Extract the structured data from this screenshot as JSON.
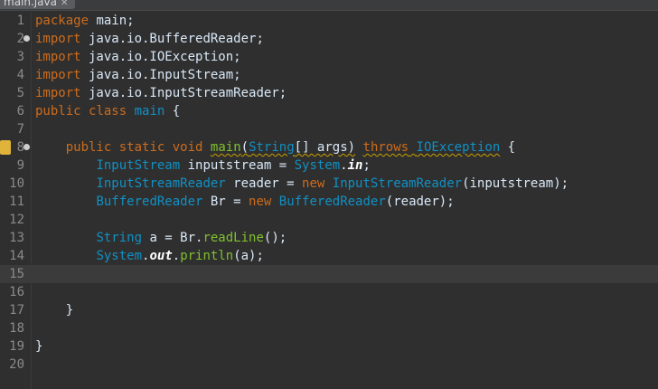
{
  "tab": {
    "label": "main.java",
    "close": "✕"
  },
  "lines": [
    {
      "n": "1",
      "tokens": [
        {
          "t": "package",
          "c": "kw"
        },
        {
          "t": " main;",
          "c": ""
        }
      ]
    },
    {
      "n": "2",
      "fold": true,
      "tokens": [
        {
          "t": "import",
          "c": "kw"
        },
        {
          "t": " java.io.BufferedReader;",
          "c": ""
        }
      ]
    },
    {
      "n": "3",
      "tokens": [
        {
          "t": "import",
          "c": "kw"
        },
        {
          "t": " java.io.IOException;",
          "c": ""
        }
      ]
    },
    {
      "n": "4",
      "tokens": [
        {
          "t": "import",
          "c": "kw"
        },
        {
          "t": " java.io.InputStream;",
          "c": ""
        }
      ]
    },
    {
      "n": "5",
      "tokens": [
        {
          "t": "import",
          "c": "kw"
        },
        {
          "t": " java.io.InputStreamReader;",
          "c": ""
        }
      ]
    },
    {
      "n": "6",
      "tokens": [
        {
          "t": "public",
          "c": "kw"
        },
        {
          "t": " ",
          "c": ""
        },
        {
          "t": "class",
          "c": "kw"
        },
        {
          "t": " ",
          "c": ""
        },
        {
          "t": "main",
          "c": "ty"
        },
        {
          "t": " {",
          "c": ""
        }
      ]
    },
    {
      "n": "7",
      "tokens": []
    },
    {
      "n": "8",
      "fold": true,
      "warn": true,
      "tokens": [
        {
          "t": "    ",
          "c": ""
        },
        {
          "t": "public",
          "c": "kw"
        },
        {
          "t": " ",
          "c": ""
        },
        {
          "t": "static",
          "c": "kw"
        },
        {
          "t": " ",
          "c": ""
        },
        {
          "t": "void",
          "c": "kw"
        },
        {
          "t": " ",
          "c": ""
        },
        {
          "t": "main",
          "c": "mt sq"
        },
        {
          "t": "(",
          "c": "sq"
        },
        {
          "t": "String",
          "c": "ty sq"
        },
        {
          "t": "[] args)",
          "c": "sq"
        },
        {
          "t": " ",
          "c": ""
        },
        {
          "t": "throws",
          "c": "kw sq"
        },
        {
          "t": " ",
          "c": "sq"
        },
        {
          "t": "IOException",
          "c": "ty sq"
        },
        {
          "t": " {",
          "c": ""
        }
      ]
    },
    {
      "n": "9",
      "tokens": [
        {
          "t": "        ",
          "c": ""
        },
        {
          "t": "InputStream",
          "c": "ty"
        },
        {
          "t": " inputstream = ",
          "c": ""
        },
        {
          "t": "System",
          "c": "ty"
        },
        {
          "t": ".",
          "c": ""
        },
        {
          "t": "in",
          "c": "it"
        },
        {
          "t": ";",
          "c": ""
        }
      ]
    },
    {
      "n": "10",
      "tokens": [
        {
          "t": "        ",
          "c": ""
        },
        {
          "t": "InputStreamReader",
          "c": "ty"
        },
        {
          "t": " reader = ",
          "c": ""
        },
        {
          "t": "new",
          "c": "kw"
        },
        {
          "t": " ",
          "c": ""
        },
        {
          "t": "InputStreamReader",
          "c": "ty"
        },
        {
          "t": "(inputstream);",
          "c": ""
        }
      ]
    },
    {
      "n": "11",
      "tokens": [
        {
          "t": "        ",
          "c": ""
        },
        {
          "t": "BufferedReader",
          "c": "ty"
        },
        {
          "t": " Br = ",
          "c": ""
        },
        {
          "t": "new",
          "c": "kw"
        },
        {
          "t": " ",
          "c": ""
        },
        {
          "t": "BufferedReader",
          "c": "ty"
        },
        {
          "t": "(reader);",
          "c": ""
        }
      ]
    },
    {
      "n": "12",
      "tokens": []
    },
    {
      "n": "13",
      "tokens": [
        {
          "t": "        ",
          "c": ""
        },
        {
          "t": "String",
          "c": "ty"
        },
        {
          "t": " a = Br.",
          "c": ""
        },
        {
          "t": "readLine",
          "c": "mt"
        },
        {
          "t": "();",
          "c": ""
        }
      ]
    },
    {
      "n": "14",
      "tokens": [
        {
          "t": "        ",
          "c": ""
        },
        {
          "t": "System",
          "c": "ty"
        },
        {
          "t": ".",
          "c": ""
        },
        {
          "t": "out",
          "c": "it"
        },
        {
          "t": ".",
          "c": ""
        },
        {
          "t": "println",
          "c": "mt"
        },
        {
          "t": "(a);",
          "c": ""
        }
      ]
    },
    {
      "n": "15",
      "current": true,
      "tokens": []
    },
    {
      "n": "16",
      "tokens": []
    },
    {
      "n": "17",
      "tokens": [
        {
          "t": "    }",
          "c": ""
        }
      ]
    },
    {
      "n": "18",
      "tokens": []
    },
    {
      "n": "19",
      "tokens": [
        {
          "t": "}",
          "c": ""
        }
      ]
    },
    {
      "n": "20",
      "tokens": []
    }
  ]
}
